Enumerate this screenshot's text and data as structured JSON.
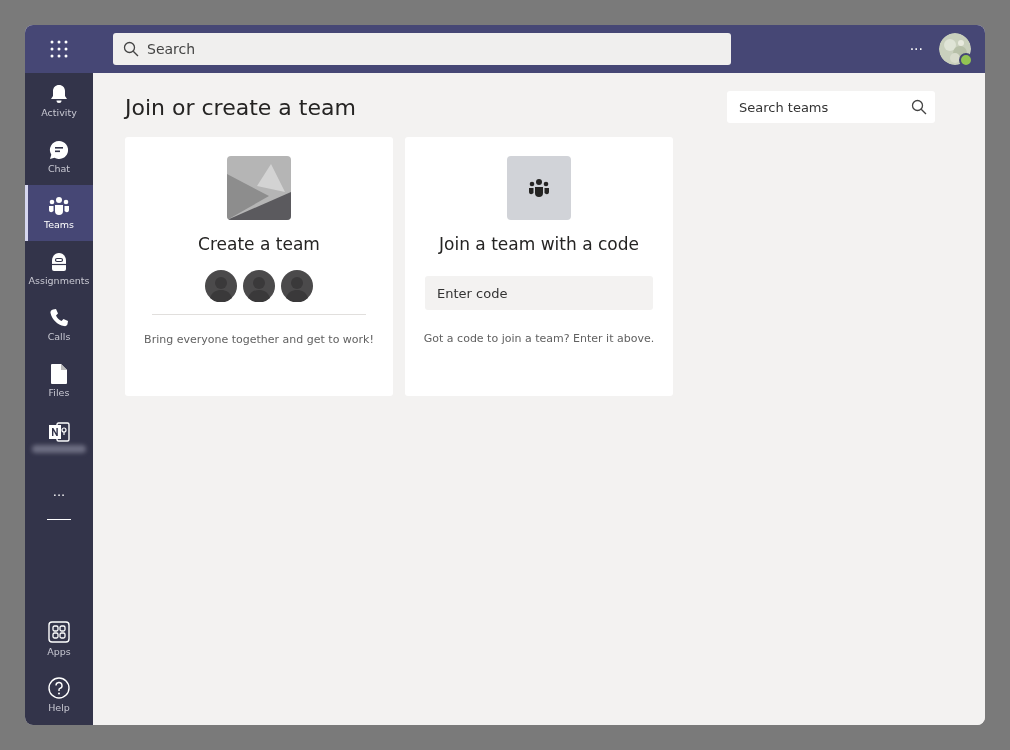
{
  "top_bar": {
    "search": {
      "placeholder": "Search"
    },
    "more": "···",
    "presence": {
      "color": "#92c353"
    }
  },
  "nav": {
    "items": [
      {
        "label": "Activity",
        "selected": false
      },
      {
        "label": "Chat",
        "selected": false
      },
      {
        "label": "Teams",
        "selected": true
      },
      {
        "label": "Assignments",
        "selected": false
      },
      {
        "label": "Calls",
        "selected": false
      },
      {
        "label": "Files",
        "selected": false
      },
      {
        "label_blurred": true,
        "selected": false
      }
    ],
    "more": "···",
    "bottom_items": [
      {
        "label": "Apps"
      },
      {
        "label": "Help"
      }
    ]
  },
  "main": {
    "title": "Join or create a team",
    "search": {
      "placeholder": "Search teams"
    },
    "cards": [
      {
        "kind": "create",
        "title": "Create a team",
        "text": "Bring everyone together and get to work!"
      },
      {
        "kind": "join",
        "title": "Join a team with a code",
        "field": {
          "placeholder": "Enter code"
        },
        "text": "Got a code to join a team? Enter it above."
      }
    ]
  }
}
